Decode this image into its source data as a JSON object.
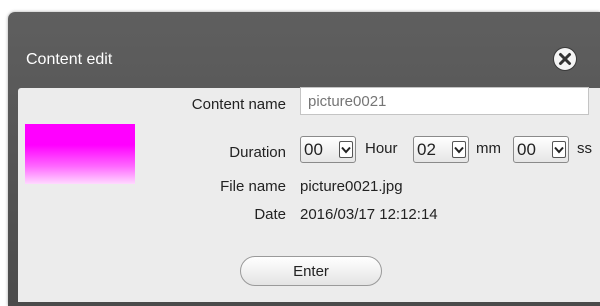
{
  "dialog": {
    "title": "Content edit",
    "close_icon": "close-circle-icon"
  },
  "form": {
    "content_name_label": "Content name",
    "content_name_placeholder": "picture0021",
    "duration_label": "Duration",
    "duration_hour": "00",
    "hour_unit": "Hour",
    "duration_minute": "02",
    "minute_unit": "mm",
    "duration_second": "00",
    "second_unit": "ss",
    "file_name_label": "File name",
    "file_name_value": "picture0021.jpg",
    "date_label": "Date",
    "date_value": "2016/03/17 12:12:14"
  },
  "actions": {
    "enter_label": "Enter"
  },
  "colors": {
    "titlebar": "#555555",
    "panel": "#ececec",
    "thumbnail": "#ff00ff"
  }
}
